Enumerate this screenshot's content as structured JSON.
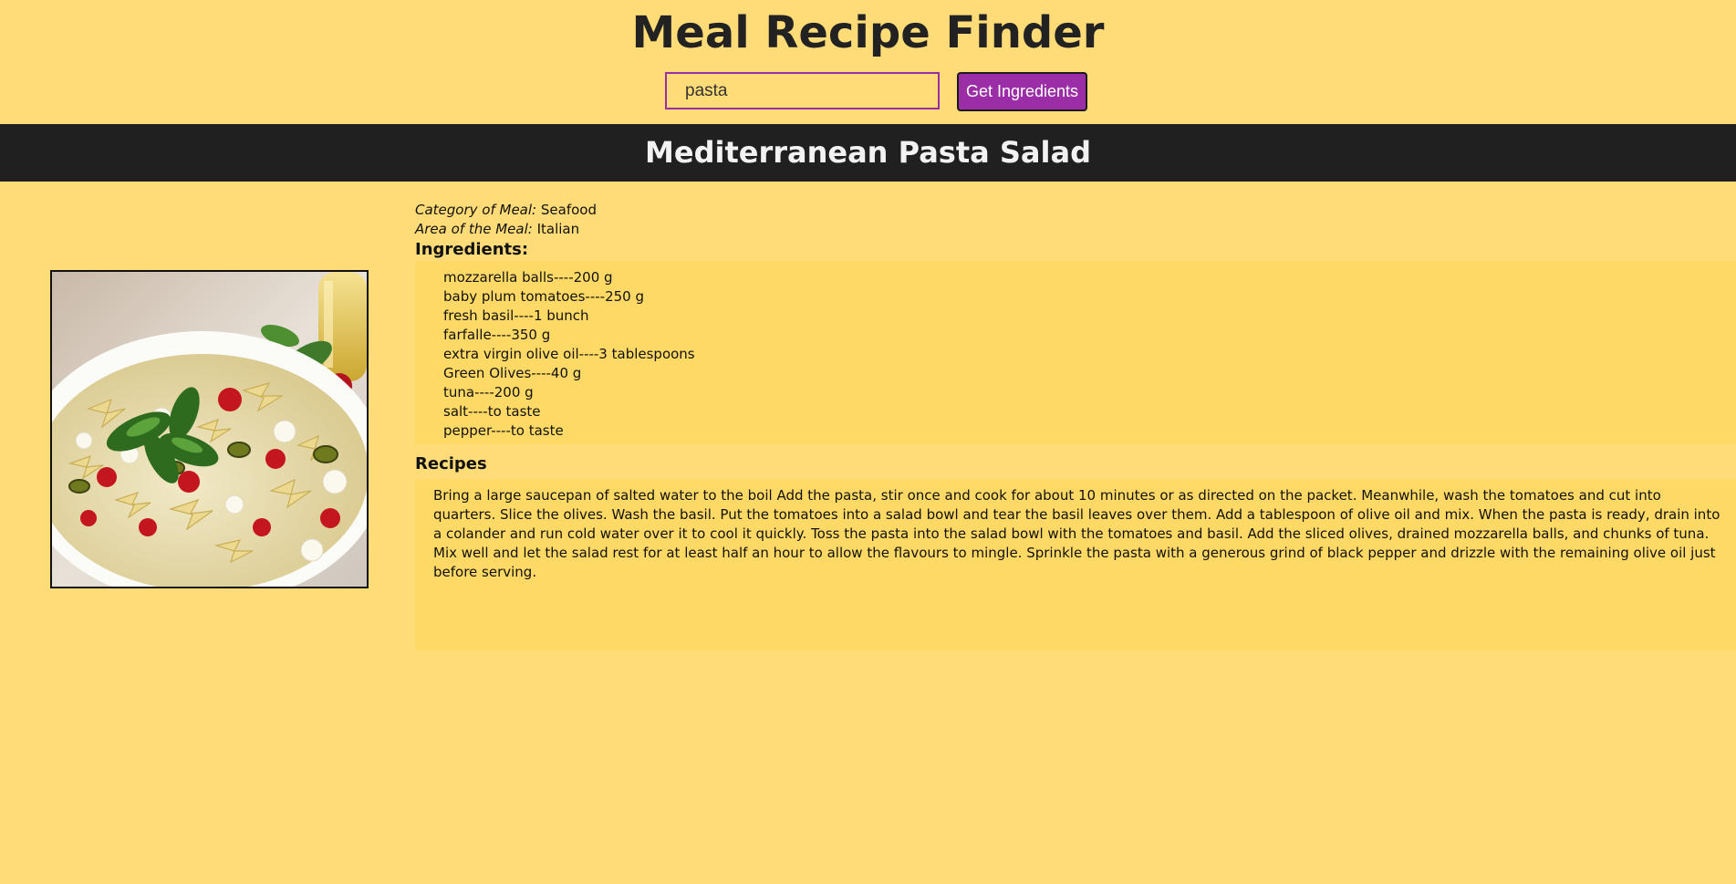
{
  "header": {
    "title": "Meal Recipe Finder"
  },
  "search": {
    "value": "pasta",
    "placeholder": "",
    "button_label": "Get Ingredients"
  },
  "meal": {
    "name": "Mediterranean Pasta Salad",
    "category_label": "Category of Meal:",
    "category": "Seafood",
    "area_label": "Area of the Meal:",
    "area": "Italian",
    "image_alt": "pasta-salad-photo"
  },
  "ingredients": {
    "heading": "Ingredients:",
    "items": [
      "mozzarella balls----200 g",
      "baby plum tomatoes----250 g",
      "fresh basil----1 bunch",
      "farfalle----350 g",
      "extra virgin olive oil----3 tablespoons",
      "Green Olives----40 g",
      "tuna----200 g",
      "salt----to taste",
      "pepper----to taste"
    ]
  },
  "recipes": {
    "heading": "Recipes",
    "text": "Bring a large saucepan of salted water to the boil Add the pasta, stir once and cook for about 10 minutes or as directed on the packet. Meanwhile, wash the tomatoes and cut into quarters. Slice the olives. Wash the basil. Put the tomatoes into a salad bowl and tear the basil leaves over them. Add a tablespoon of olive oil and mix. When the pasta is ready, drain into a colander and run cold water over it to cool it quickly. Toss the pasta into the salad bowl with the tomatoes and basil. Add the sliced olives, drained mozzarella balls, and chunks of tuna. Mix well and let the salad rest for at least half an hour to allow the flavours to mingle. Sprinkle the pasta with a generous grind of black pepper and drizzle with the remaining olive oil just before serving."
  },
  "colors": {
    "page_background": "#FFDC77",
    "panel_background": "#FFD966",
    "accent": "#9B2DA6",
    "title_bar": "#202020"
  }
}
